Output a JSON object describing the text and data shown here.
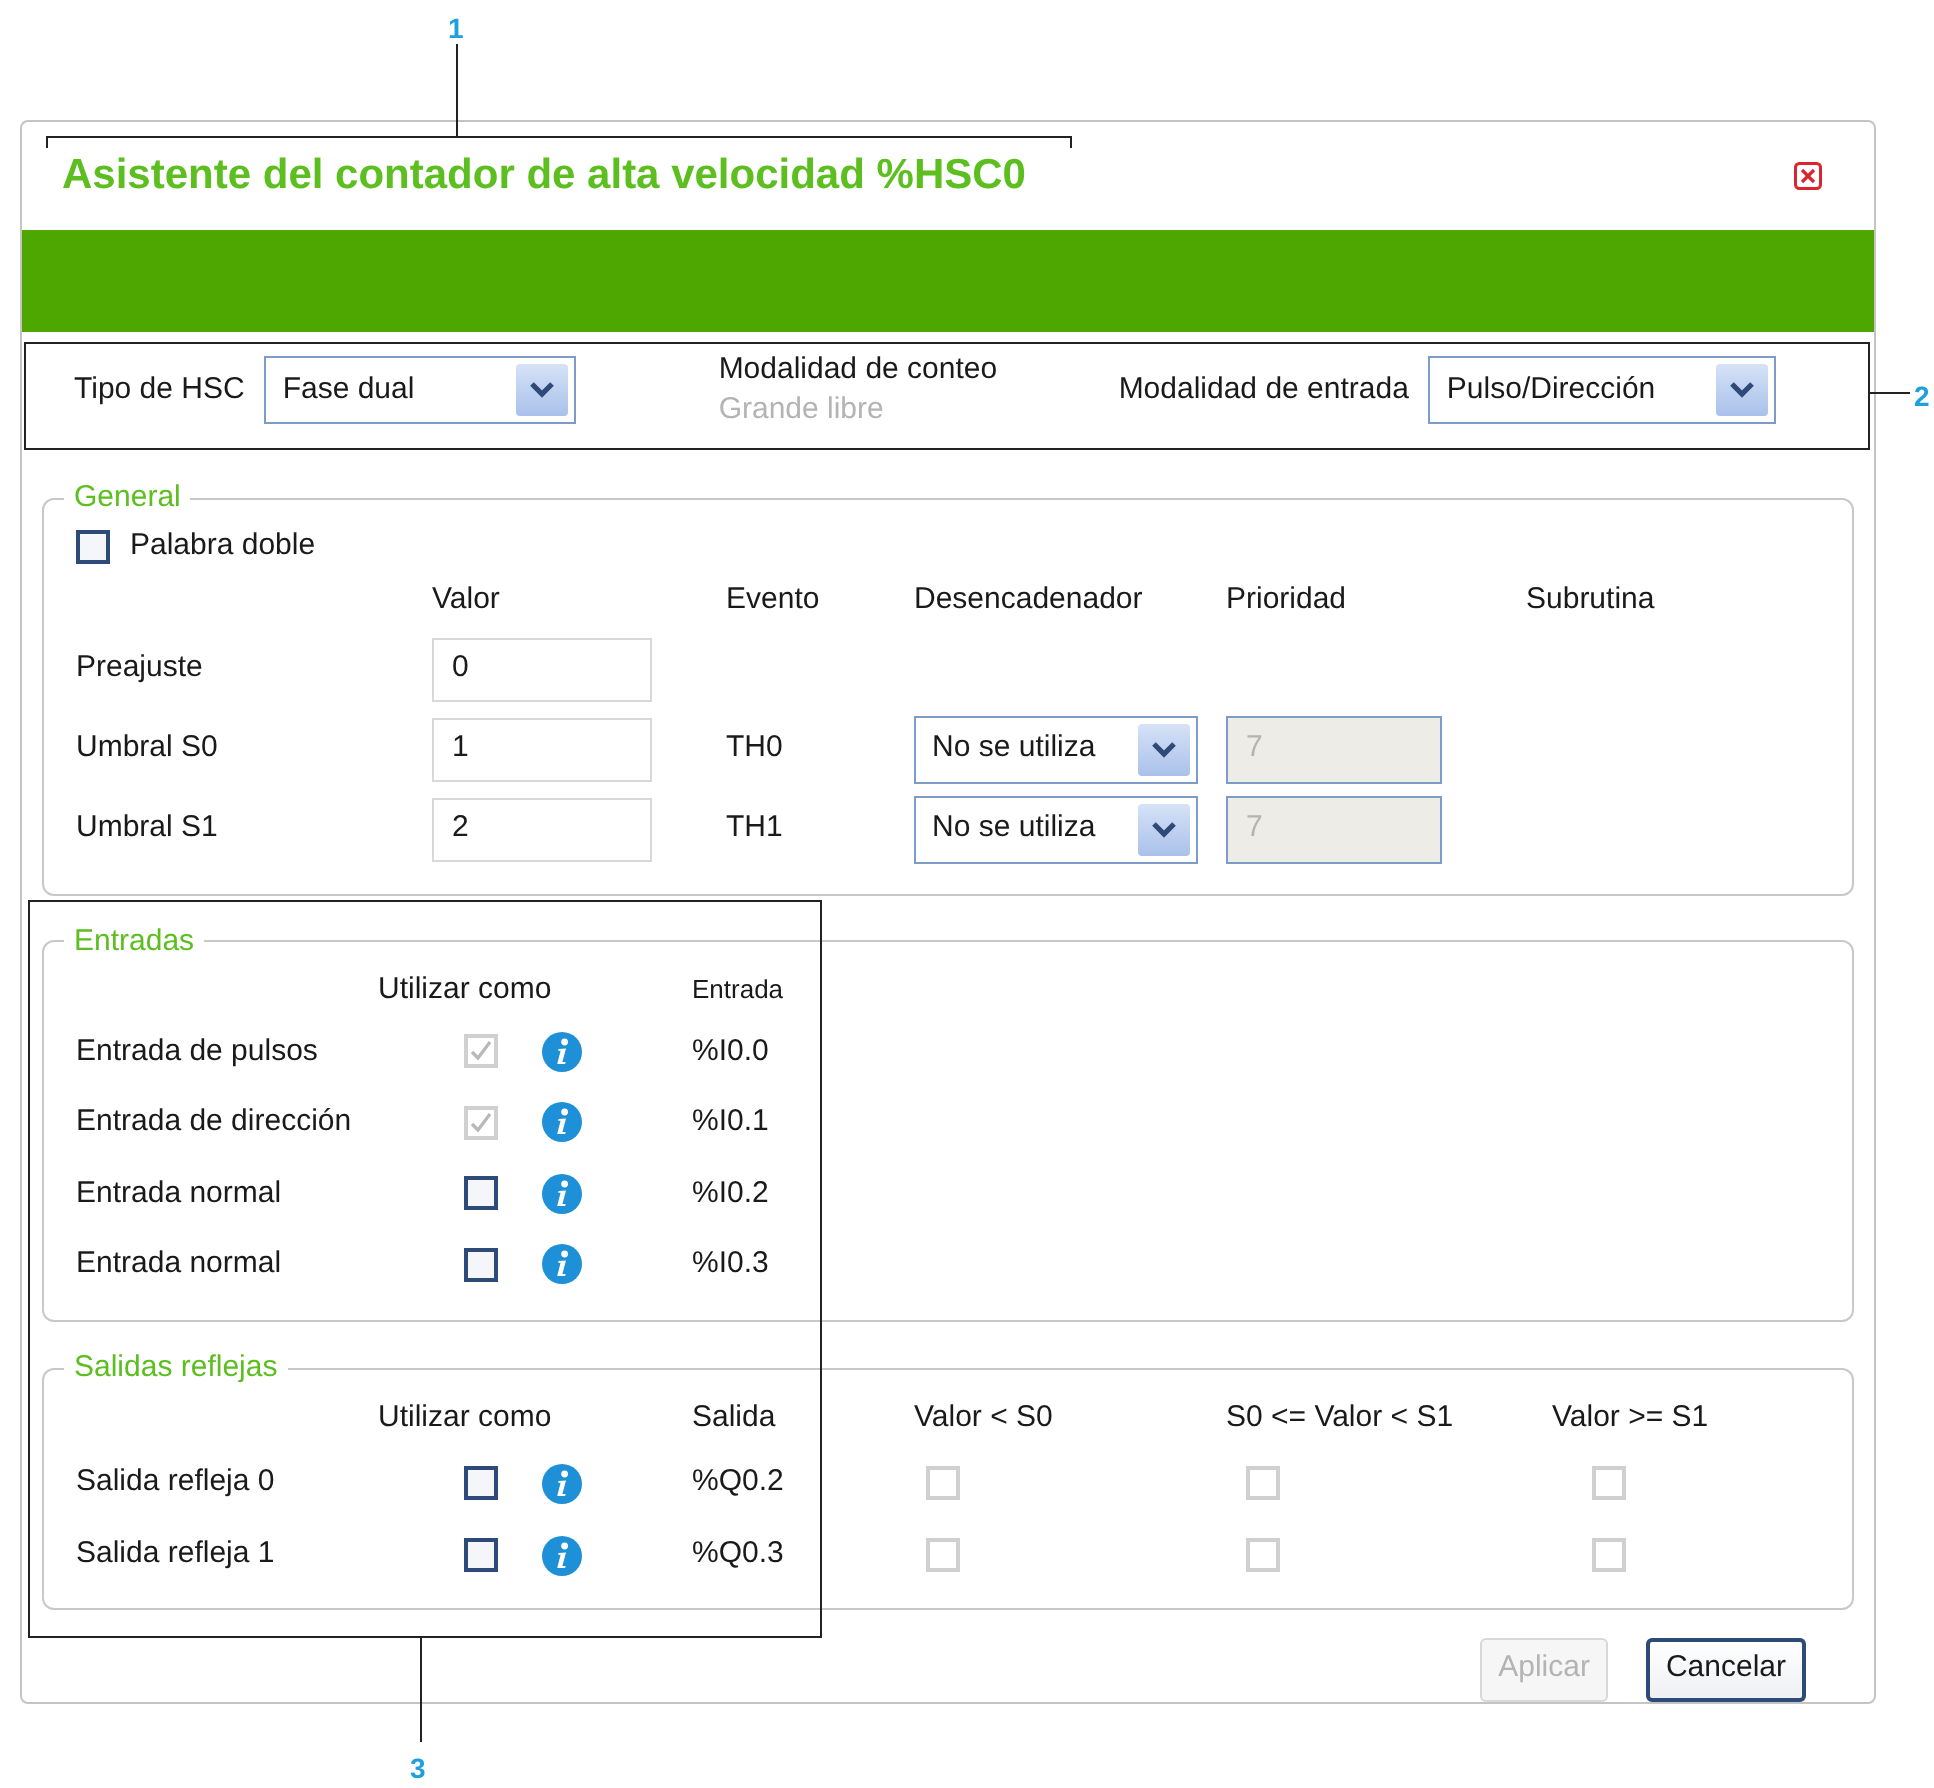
{
  "callouts": [
    "1",
    "2",
    "3"
  ],
  "dialog": {
    "title": "Asistente del contador de alta velocidad %HSC0"
  },
  "mode_bar": {
    "hsc_type": {
      "label": "Tipo de HSC",
      "value": "Fase dual"
    },
    "count_mode": {
      "label": "Modalidad de conteo",
      "value": "Grande libre"
    },
    "input_mode": {
      "label": "Modalidad de entrada",
      "value": "Pulso/Dirección"
    }
  },
  "general": {
    "title": "General",
    "double_word": {
      "label": "Palabra doble",
      "checked": false
    },
    "columns": [
      "Valor",
      "Evento",
      "Desencadenador",
      "Prioridad",
      "Subrutina"
    ],
    "rows": [
      {
        "label": "Preajuste",
        "value": "0"
      },
      {
        "label": "Umbral S0",
        "value": "1",
        "event": "TH0",
        "trigger": "No se utiliza",
        "priority": "7"
      },
      {
        "label": "Umbral S1",
        "value": "2",
        "event": "TH1",
        "trigger": "No se utiliza",
        "priority": "7"
      }
    ]
  },
  "inputs": {
    "title": "Entradas",
    "columns": [
      "Utilizar como",
      "Entrada"
    ],
    "rows": [
      {
        "label": "Entrada de pulsos",
        "checked": true,
        "disabled": true,
        "address": "%I0.0"
      },
      {
        "label": "Entrada de dirección",
        "checked": true,
        "disabled": true,
        "address": "%I0.1"
      },
      {
        "label": "Entrada normal",
        "checked": false,
        "disabled": false,
        "address": "%I0.2"
      },
      {
        "label": "Entrada normal",
        "checked": false,
        "disabled": false,
        "address": "%I0.3"
      }
    ]
  },
  "outputs": {
    "title": "Salidas reflejas",
    "columns": [
      "Utilizar como",
      "Salida",
      "Valor < S0",
      "S0 <= Valor < S1",
      "Valor >= S1"
    ],
    "rows": [
      {
        "label": "Salida refleja 0",
        "checked": false,
        "address": "%Q0.2",
        "conditions": [
          {
            "checked": false,
            "disabled": true
          },
          {
            "checked": false,
            "disabled": true
          },
          {
            "checked": false,
            "disabled": true
          }
        ]
      },
      {
        "label": "Salida refleja 1",
        "checked": false,
        "address": "%Q0.3",
        "conditions": [
          {
            "checked": false,
            "disabled": true
          },
          {
            "checked": false,
            "disabled": true
          },
          {
            "checked": false,
            "disabled": true
          }
        ]
      }
    ]
  },
  "buttons": [
    {
      "label": "Aplicar",
      "disabled": true
    },
    {
      "label": "Cancelar",
      "disabled": false
    }
  ]
}
